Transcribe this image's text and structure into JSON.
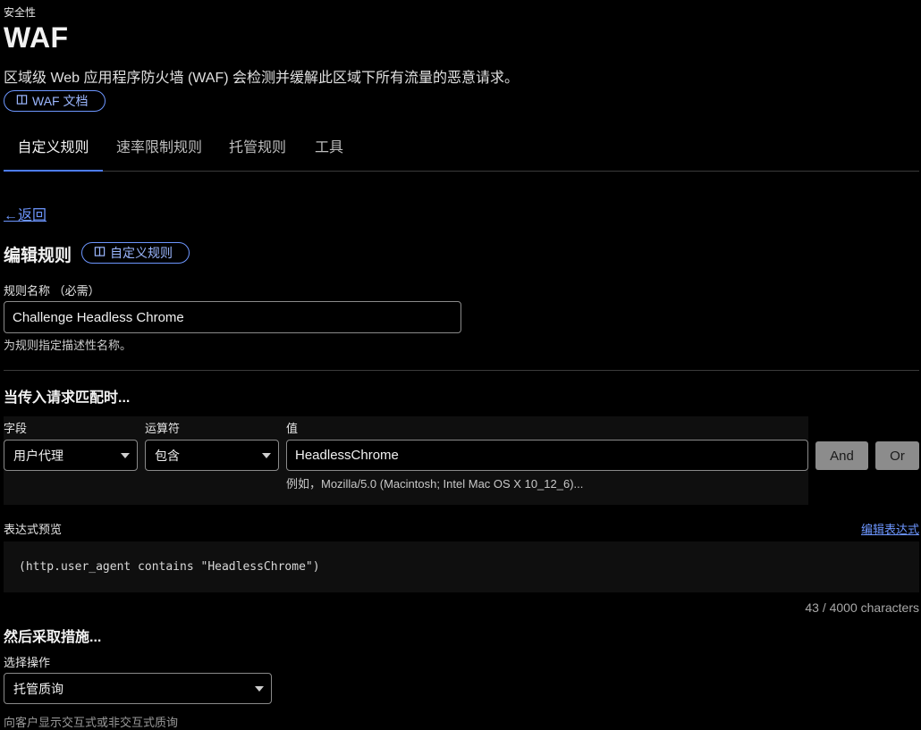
{
  "header": {
    "section": "安全性",
    "title": "WAF",
    "description": "区域级 Web 应用程序防火墙 (WAF) 会检测并缓解此区域下所有流量的恶意请求。",
    "doc_link": "WAF 文档"
  },
  "tabs": [
    {
      "label": "自定义规则",
      "active": true
    },
    {
      "label": "速率限制规则",
      "active": false
    },
    {
      "label": "托管规则",
      "active": false
    },
    {
      "label": "工具",
      "active": false
    }
  ],
  "back_link": "←返回",
  "edit": {
    "title": "编辑规则",
    "doc_link": "自定义规则",
    "name_label": "规则名称 （必需）",
    "name_value": "Challenge Headless Chrome",
    "name_hint": "为规则指定描述性名称。"
  },
  "match": {
    "title": "当传入请求匹配时...",
    "field_label": "字段",
    "field_value": "用户代理",
    "operator_label": "运算符",
    "operator_value": "包含",
    "value_label": "值",
    "value_value": "HeadlessChrome",
    "value_hint": "例如，Mozilla/5.0 (Macintosh; Intel Mac OS X 10_12_6)...",
    "and_button": "And",
    "or_button": "Or"
  },
  "expression": {
    "label": "表达式预览",
    "edit_link": "编辑表达式",
    "code": "(http.user_agent contains \"HeadlessChrome\")",
    "char_count": "43 / 4000 characters"
  },
  "action": {
    "title": "然后采取措施...",
    "select_label": "选择操作",
    "select_value": "托管质询",
    "hint": "向客户显示交互式或非交互式质询"
  },
  "colors": {
    "accent": "#4d7cff",
    "link": "#6d96ff",
    "background": "#000000"
  }
}
